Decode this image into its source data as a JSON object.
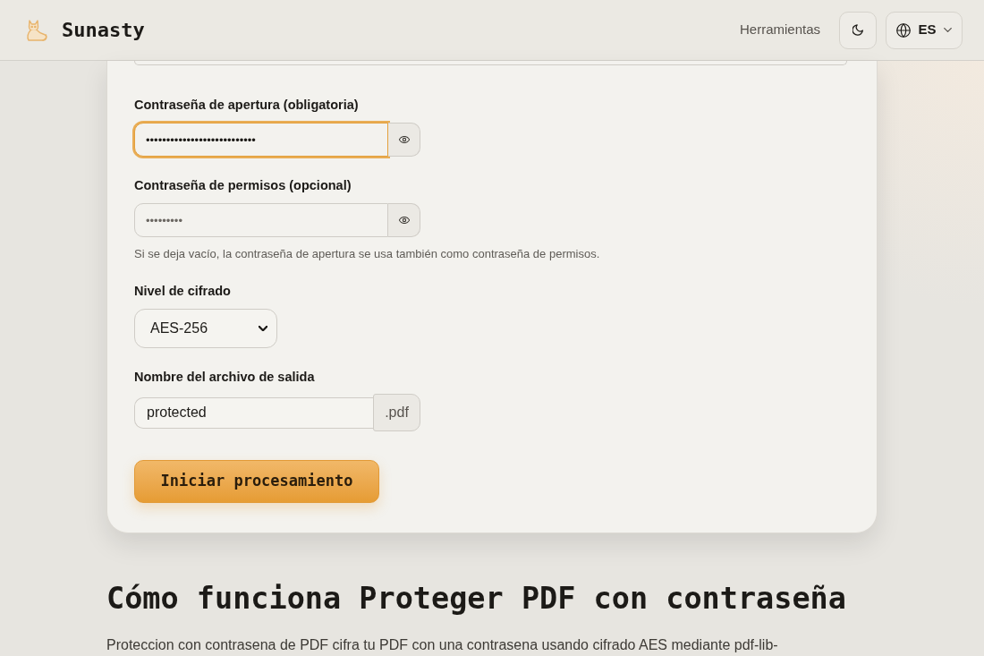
{
  "header": {
    "brand": "Sunasty",
    "nav_link": "Herramientas",
    "language": "ES"
  },
  "form": {
    "fields": [
      {
        "kind": "password",
        "label": "Contraseña de apertura (obligatoria)",
        "value": "•••••••••••••••••••••••••••",
        "focused": true
      },
      {
        "kind": "password",
        "label": "Contraseña de permisos (opcional)",
        "value": "•••••••••",
        "focused": false,
        "hint": "Si se deja vacío, la contraseña de apertura se usa también como contraseña de permisos."
      },
      {
        "kind": "select",
        "label": "Nivel de cifrado",
        "value": "AES-256",
        "focused": false
      },
      {
        "kind": "filename",
        "label": "Nombre del archivo de salida",
        "value": "protected",
        "suffix": ".pdf",
        "focused": false
      }
    ],
    "submit_button": "Iniciar procesamiento"
  },
  "section": {
    "heading": "Cómo funciona Proteger PDF con contraseña",
    "paragraph": "Proteccion con contrasena de PDF cifra tu PDF con una contrasena usando cifrado AES mediante pdf-lib-"
  }
}
